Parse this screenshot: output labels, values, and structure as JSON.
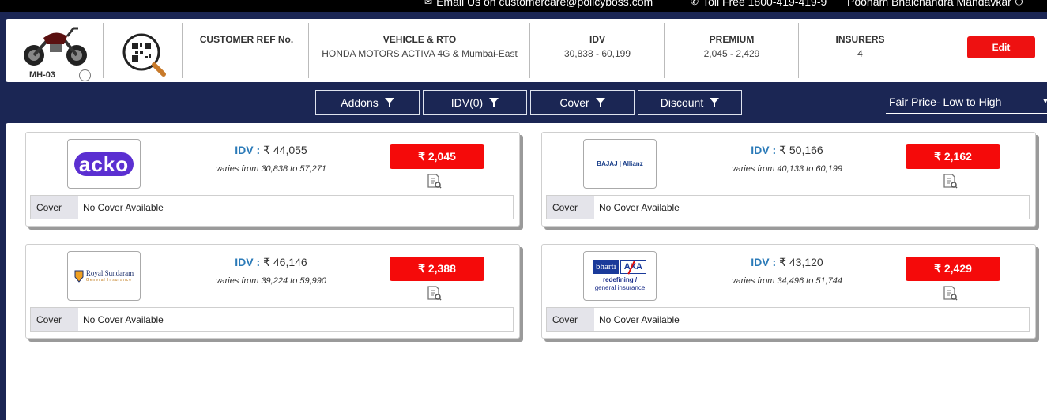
{
  "topbar": {
    "email": "Email Us on customercare@policyboss.com",
    "tollfree": "Toll Free 1800-419-419-9",
    "user": "Poonam Bhaichandra Mandavkar"
  },
  "header": {
    "rto_code": "MH-03",
    "info_glyph": "i",
    "customer_ref_label": "CUSTOMER REF No.",
    "vehicle_label": "VEHICLE & RTO",
    "vehicle_value": "HONDA MOTORS ACTIVA 4G & Mumbai-East",
    "idv_label": "IDV",
    "idv_value": "30,838 - 60,199",
    "premium_label": "PREMIUM",
    "premium_value": "2,045 - 2,429",
    "insurers_label": "INSURERS",
    "insurers_value": "4",
    "edit_label": "Edit"
  },
  "filters": {
    "addons": "Addons",
    "idv": "IDV(0)",
    "cover": "Cover",
    "discount": "Discount"
  },
  "sort": {
    "label": "Fair Price- Low to High"
  },
  "quotes": [
    {
      "insurer": "acko",
      "logo_text": "acko",
      "idv_key": "IDV :",
      "idv": "₹ 44,055",
      "varies": "varies from 30,838 to 57,271",
      "premium": "₹ 2,045",
      "cover_label": "Cover",
      "cover_value": "No Cover Available"
    },
    {
      "insurer": "bajaj-allianz",
      "logo_text": "BAJAJ | Allianz",
      "idv_key": "IDV :",
      "idv": "₹ 50,166",
      "varies": "varies from 40,133 to 60,199",
      "premium": "₹ 2,162",
      "cover_label": "Cover",
      "cover_value": "No Cover Available"
    },
    {
      "insurer": "royal-sundaram",
      "logo_text": "Royal Sundaram",
      "logo_sub": "General Insurance",
      "idv_key": "IDV :",
      "idv": "₹ 46,146",
      "varies": "varies from 39,224 to 59,990",
      "premium": "₹ 2,388",
      "cover_label": "Cover",
      "cover_value": "No Cover Available"
    },
    {
      "insurer": "bharti-axa",
      "logo_text": "bharti",
      "logo_text2": "AXA",
      "logo_line1": "redefining /",
      "logo_line2": "general insurance",
      "idv_key": "IDV :",
      "idv": "₹ 43,120",
      "varies": "varies from 34,496 to 51,744",
      "premium": "₹ 2,429",
      "cover_label": "Cover",
      "cover_value": "No Cover Available"
    }
  ],
  "colors": {
    "navy": "#1b2654",
    "red": "#f50a0a",
    "idv_blue": "#2a7ab8"
  },
  "icons": [
    "envelope-icon",
    "phone-icon",
    "power-icon",
    "bike-image",
    "qr-search-icon",
    "info-icon",
    "funnel-icon",
    "chevron-down-icon",
    "document-search-icon"
  ]
}
